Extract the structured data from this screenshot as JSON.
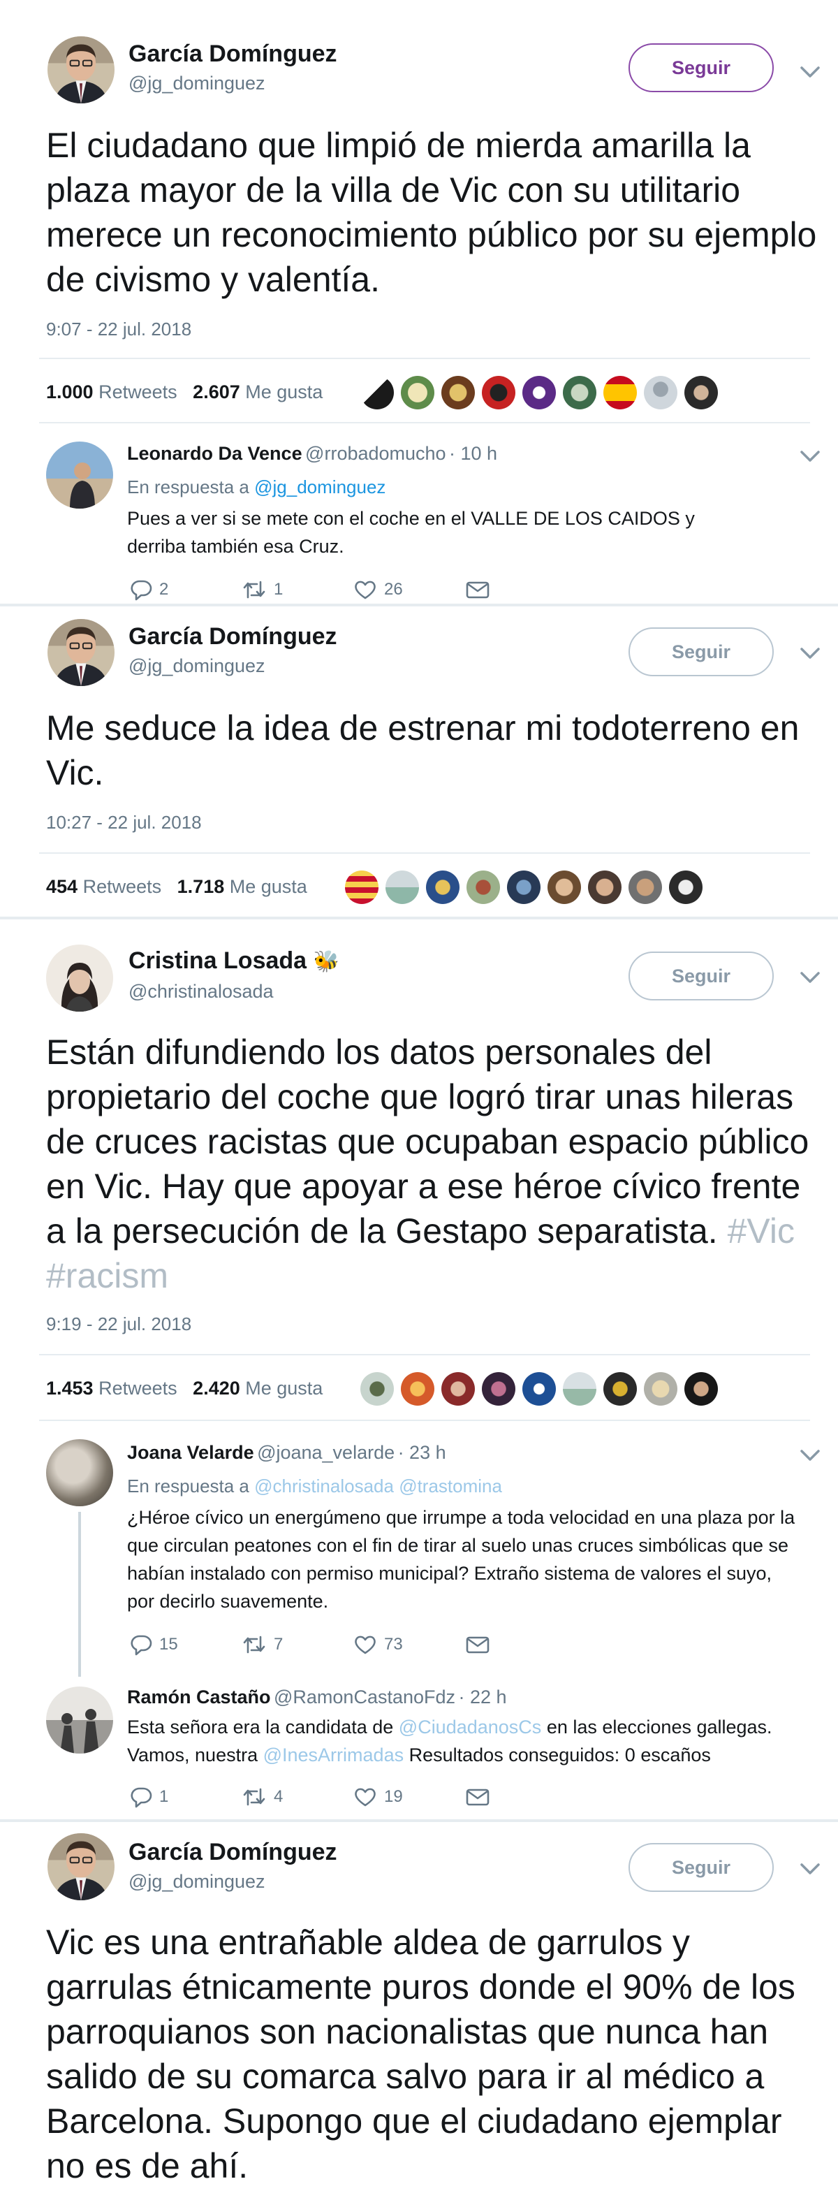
{
  "tweets": [
    {
      "author": "García Domínguez",
      "handle": "@jg_dominguez",
      "follow_label": "Seguir",
      "text": "El ciudadano que limpió de mierda amarilla la plaza mayor de la villa de Vic con su utilitario merece un reconocimiento público por su ejemplo de civismo y valentía.",
      "time": "9:07 - 22 jul. 2018",
      "retweets": "1.000",
      "retweets_label": "Retweets",
      "likes": "2.607",
      "likes_label": "Me gusta",
      "reply": {
        "author": "Leonardo Da Vence",
        "handle": "@rrobadomucho",
        "ago": "· 10 h",
        "in_reply_prefix": "En respuesta a",
        "in_reply_to": "@jg_dominguez",
        "text": "Pues a ver si se mete con el coche  en el VALLE DE LOS CAIDOS y derriba también esa Cruz.",
        "replies": "2",
        "retweets": "1",
        "likes": "26"
      }
    },
    {
      "author": "García Domínguez",
      "handle": "@jg_dominguez",
      "follow_label": "Seguir",
      "text": "Me seduce la idea de estrenar mi todoterreno en Vic.",
      "time": "10:27 - 22 jul. 2018",
      "retweets": "454",
      "retweets_label": "Retweets",
      "likes": "1.718",
      "likes_label": "Me gusta"
    },
    {
      "author": "Cristina Losada",
      "author_emoji": "🐝",
      "handle": "@christinalosada",
      "follow_label": "Seguir",
      "text": "Están difundiendo los datos personales del propietario del coche que logró tirar unas hileras de cruces racistas que ocupaban espacio público en Vic. Hay que apoyar a ese héroe cívico frente a la persecución de la Gestapo separatista.",
      "hashtags": "#Vic #racism",
      "time": "9:19 - 22 jul. 2018",
      "retweets": "1.453",
      "retweets_label": "Retweets",
      "likes": "2.420",
      "likes_label": "Me gusta",
      "reply1": {
        "author": "Joana Velarde",
        "handle": "@joana_velarde",
        "ago": "· 23 h",
        "in_reply_prefix": "En respuesta a",
        "in_reply_to_1": "@christinalosada",
        "in_reply_to_2": "@trastomina",
        "text": "¿Héroe cívico un energúmeno que irrumpe a toda velocidad en una plaza por la que circulan peatones con el fin de tirar al suelo unas cruces simbólicas que se habían instalado con permiso municipal? Extraño sistema de valores el suyo, por decirlo suavemente.",
        "replies": "15",
        "retweets": "7",
        "likes": "73"
      },
      "reply2": {
        "author": "Ramón Castaño",
        "handle": "@RamonCastanoFdz",
        "ago": "· 22 h",
        "text_a": "Esta señora era la candidata de",
        "mention_a": "@CiudadanosCs",
        "text_b": "en las elecciones gallegas.",
        "text_c": "Vamos, nuestra",
        "mention_b": "@InesArrimadas",
        "text_d": "Resultados conseguidos: 0 escaños",
        "replies": "1",
        "retweets": "4",
        "likes": "19"
      }
    },
    {
      "author": "García Domínguez",
      "handle": "@jg_dominguez",
      "follow_label": "Seguir",
      "text": "Vic es una entrañable aldea de garrulos y garrulas étnicamente puros donde el 90% de los parroquianos son nacionalistas que nunca han salido de su comarca salvo para ir al médico a Barcelona. Supongo que el ciudadano ejemplar no es de ahí."
    }
  ],
  "colors": {
    "text": "#14171a",
    "secondary": "#657786",
    "link": "#1b95e0",
    "hashtag_faded": "#b2bdc6",
    "follow_active": "#7a3a97",
    "divider": "#e6ecf0"
  }
}
